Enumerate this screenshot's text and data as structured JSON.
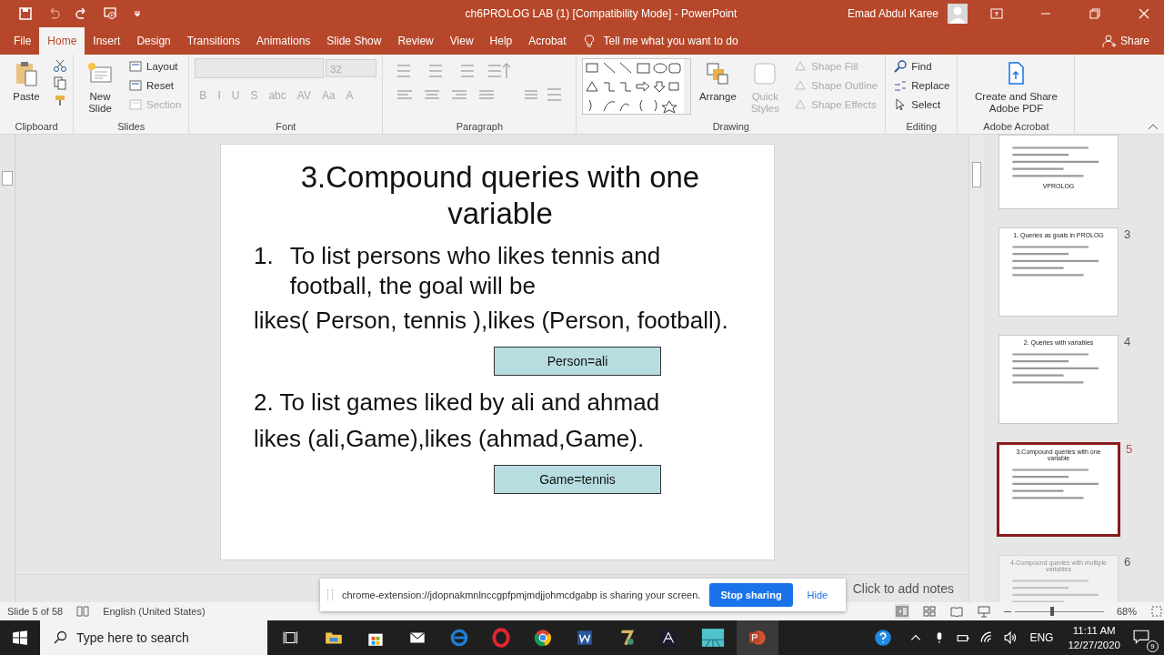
{
  "window": {
    "title": "ch6PROLOG LAB (1) [Compatibility Mode]  -  PowerPoint",
    "user": "Emad Abdul Karee"
  },
  "tabs": [
    {
      "label": "File",
      "selected": false
    },
    {
      "label": "Home",
      "selected": true
    },
    {
      "label": "Insert",
      "selected": false
    },
    {
      "label": "Design",
      "selected": false
    },
    {
      "label": "Transitions",
      "selected": false
    },
    {
      "label": "Animations",
      "selected": false
    },
    {
      "label": "Slide Show",
      "selected": false
    },
    {
      "label": "Review",
      "selected": false
    },
    {
      "label": "View",
      "selected": false
    },
    {
      "label": "Help",
      "selected": false
    },
    {
      "label": "Acrobat",
      "selected": false
    }
  ],
  "tell_me": "Tell me what you want to do",
  "share": "Share",
  "ribbon": {
    "clipboard": {
      "label": "Clipboard",
      "paste": "Paste"
    },
    "slides": {
      "label": "Slides",
      "new_slide": "New Slide",
      "commands": [
        {
          "label": "Layout",
          "disabled": false
        },
        {
          "label": "Reset",
          "disabled": false
        },
        {
          "label": "Section",
          "disabled": true
        }
      ]
    },
    "font": {
      "label": "Font",
      "size": "32",
      "disabled": true,
      "buttons": [
        "B",
        "I",
        "U",
        "S",
        "abc",
        "AV",
        "Aa",
        "A"
      ]
    },
    "paragraph": {
      "label": "Paragraph"
    },
    "drawing": {
      "label": "Drawing",
      "arrange": "Arrange",
      "quick_styles": "Quick Styles",
      "commands": [
        {
          "label": "Shape Fill",
          "disabled": true
        },
        {
          "label": "Shape Outline",
          "disabled": true
        },
        {
          "label": "Shape Effects",
          "disabled": true
        }
      ]
    },
    "editing": {
      "label": "Editing",
      "commands": [
        "Find",
        "Replace",
        "Select"
      ]
    },
    "acrobat": {
      "label": "Adobe Acrobat",
      "button": "Create and Share Adobe PDF"
    }
  },
  "slide": {
    "title": "3.Compound queries with one variable",
    "blocks": [
      {
        "kind": "numbered",
        "number": "1.",
        "text": "To list persons who likes tennis and football, the goal will be"
      },
      {
        "kind": "line",
        "text": "likes( Person, tennis  ),likes (Person, football)."
      },
      {
        "kind": "box",
        "text": "Person=ali"
      },
      {
        "kind": "line",
        "text": "2. To list games  liked by ali and ahmad"
      },
      {
        "kind": "line",
        "text": "likes (ali,Game),likes (ahmad,Game)."
      },
      {
        "kind": "box",
        "text": "Game=tennis"
      }
    ]
  },
  "notes_placeholder": "Click to add notes",
  "thumbnails": [
    {
      "title": "VPROLOG",
      "selected": false,
      "faded": false,
      "cut": true
    },
    {
      "number": "3",
      "title": "1. Queries as goals in PROLOG",
      "selected": false,
      "faded": false,
      "cut": false
    },
    {
      "number": "4",
      "title": "2. Queries with variables",
      "selected": false,
      "faded": false,
      "cut": false
    },
    {
      "number": "5",
      "title": "3.Compound queries with one variable",
      "selected": true,
      "faded": false,
      "cut": false
    },
    {
      "number": "6",
      "title": "4-Compound queries with multiple variables",
      "selected": false,
      "faded": true,
      "cut": false
    }
  ],
  "status": {
    "slide": "Slide 5 of 58",
    "language": "English (United States)",
    "zoom": "68%",
    "zoom_level": {
      "level": 0.4
    }
  },
  "share_bar": {
    "message": "chrome-extension://jdopnakmnlnccgpfpmjmdjjohmcdgabp is sharing your screen.",
    "stop": "Stop sharing",
    "hide": "Hide"
  },
  "taskbar": {
    "search_placeholder": "Type here to search",
    "language": "ENG",
    "time": "11:11 AM",
    "date": "12/27/2020",
    "notifications": "9"
  }
}
